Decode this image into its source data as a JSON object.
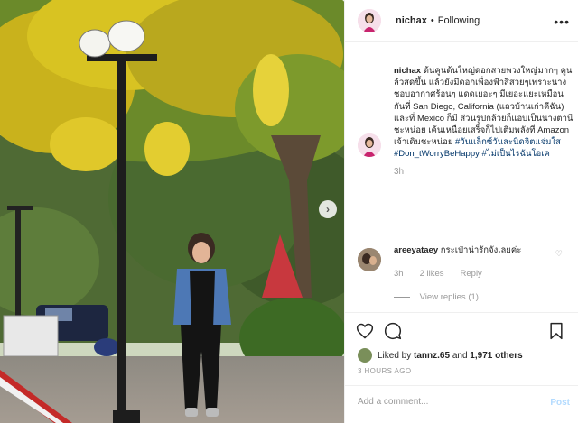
{
  "header": {
    "username": "nichax",
    "separator": "•",
    "follow_status": "Following",
    "more_icon": "more-horizontal-icon"
  },
  "caption": {
    "username": "nichax",
    "text_1": "ต้นคูนต้นใหญ่ดอกสวยพวงใหญ่มากๆ",
    "text_2": "คูนล้วสดขึ้น แล้วยังมีดอกเพื่องฟ้าสีสวยๆเพราะนางชอบอากาศร้อนๆ แดดเยอะๆ",
    "text_3": "มีเยอะแยะเหมือนกันที่ San Diego, California (แถวบ้านเก่าดีฉัน) และที่ Mexico ก็มี",
    "text_4": "ส่วนรูปกล้วยก็แอบเป็นนางตานีชะหน่อย",
    "text_5": "เค้นเหนื่อยเสร็จก็ไปเติมพลังที่ Amazon เจ้าเดิมชะหน่อย",
    "hashtag_1": "#วันแล็กซ์วันละนิดจิตแจ่มใส",
    "hashtag_2": "#Don_tWorryBeHappy",
    "hashtag_3": "#ไม่เป็นไรฉันโอเค",
    "time": "3h"
  },
  "comments": [
    {
      "username": "areeyataey",
      "text": "กระเป๋าน่ารักจังเลยค่ะ",
      "time": "3h",
      "likes": "2 likes",
      "reply_label": "Reply",
      "view_replies": "View replies (1)"
    }
  ],
  "likes": {
    "prefix": "Liked by",
    "first_user": "tannz.65",
    "connector": "and",
    "others": "1,971 others"
  },
  "timestamp": "3 HOURS AGO",
  "add_comment": {
    "placeholder": "Add a comment...",
    "post_label": "Post"
  },
  "icons": {
    "like": "heart-icon",
    "comment": "comment-icon",
    "save": "bookmark-icon",
    "next": "chevron-right-icon"
  }
}
